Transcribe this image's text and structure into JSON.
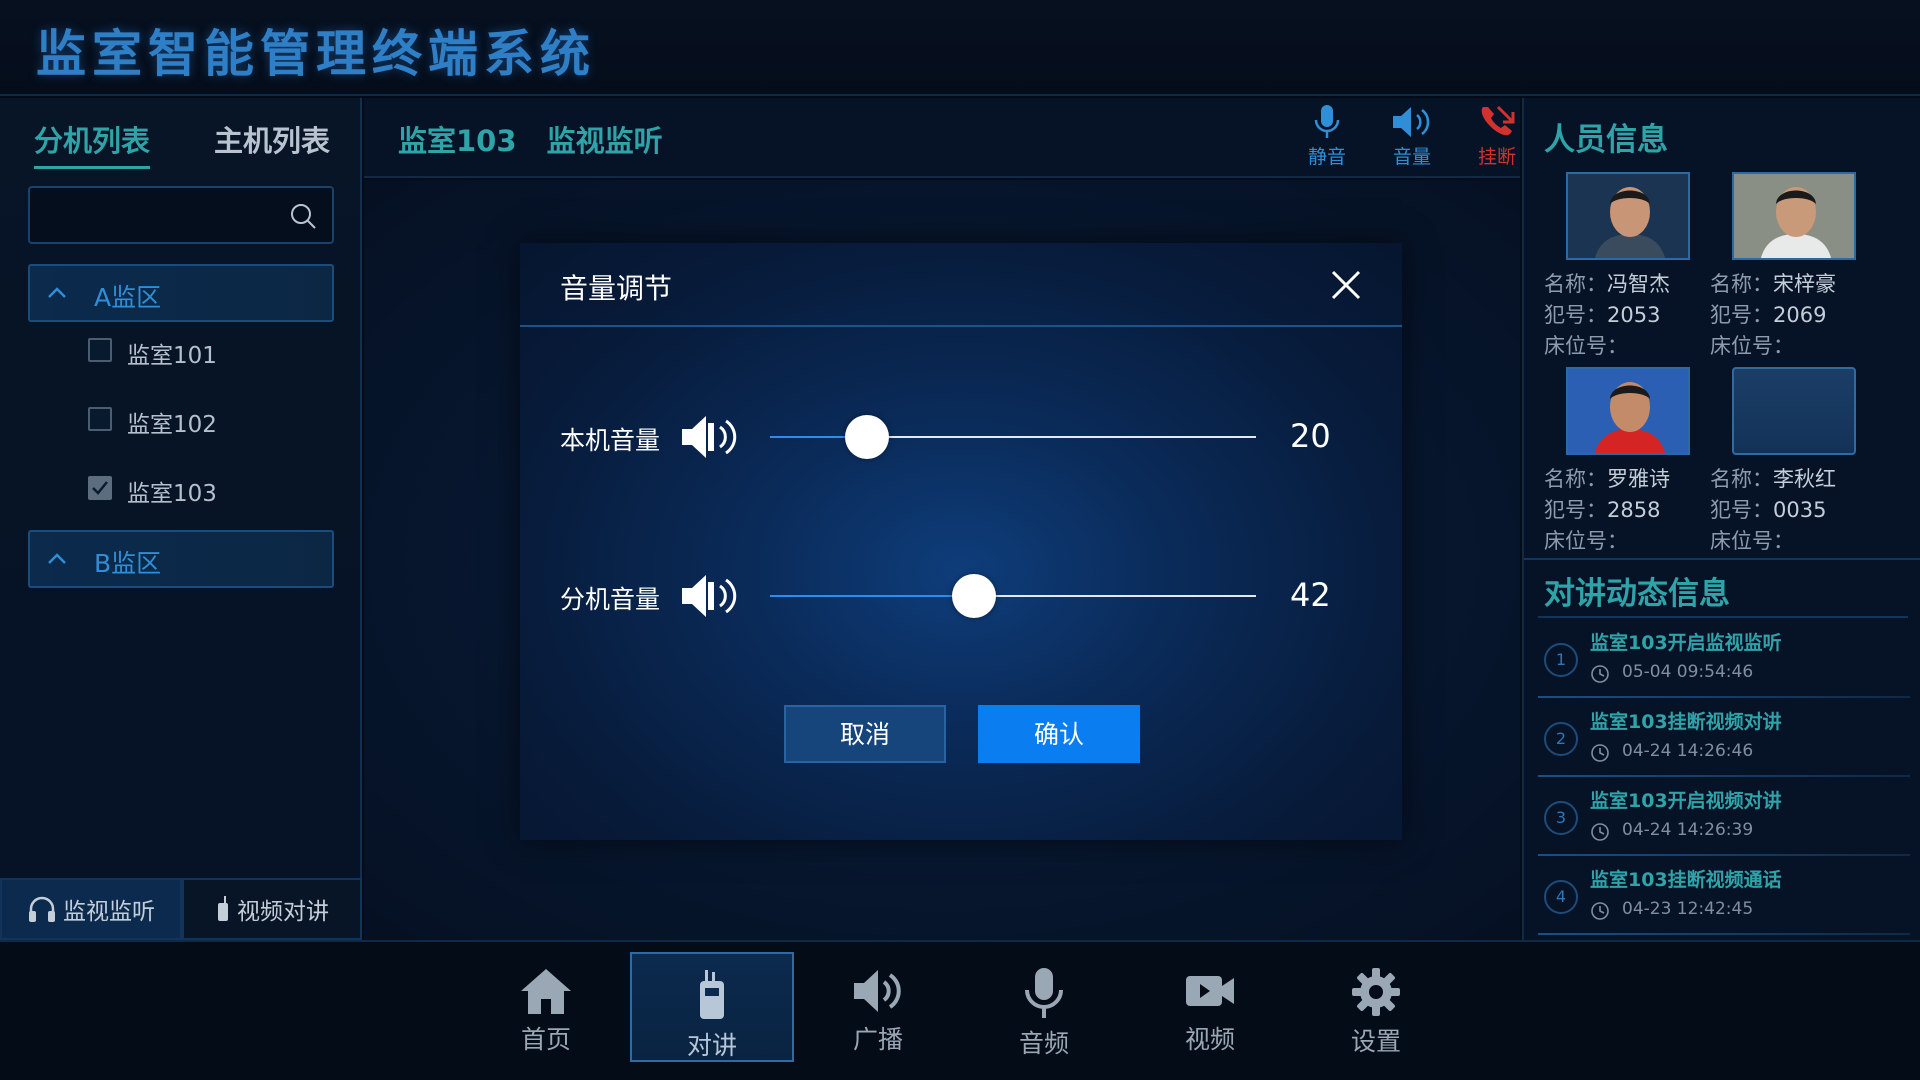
{
  "app": {
    "title": "监室智能管理终端系统"
  },
  "left_panel": {
    "tabs": [
      {
        "label": "分机列表",
        "active": true
      },
      {
        "label": "主机列表",
        "active": false
      }
    ],
    "search": {
      "placeholder": "",
      "value": ""
    },
    "zones": [
      {
        "label": "A监区",
        "expanded": true,
        "rooms": [
          {
            "label": "监室101",
            "checked": false
          },
          {
            "label": "监室102",
            "checked": false
          },
          {
            "label": "监室103",
            "checked": true
          }
        ]
      },
      {
        "label": "B监区",
        "expanded": true,
        "rooms": []
      }
    ],
    "bottom_tabs": [
      {
        "label": "监视监听",
        "icon": "headphones-icon",
        "active": true
      },
      {
        "label": "视频对讲",
        "icon": "walkie-talkie-icon",
        "active": false
      }
    ]
  },
  "center": {
    "breadcrumb": {
      "room": "监室103",
      "mode": "监视监听"
    },
    "controls": [
      {
        "label": "静音",
        "icon": "microphone-icon"
      },
      {
        "label": "音量",
        "icon": "speaker-icon"
      },
      {
        "label": "挂断",
        "icon": "hangup-icon"
      }
    ]
  },
  "volume_dialog": {
    "title": "音量调节",
    "local": {
      "label": "本机音量",
      "value": 20
    },
    "extension": {
      "label": "分机音量",
      "value": 42
    },
    "cancel_label": "取消",
    "confirm_label": "确认"
  },
  "right_panel": {
    "persons_title": "人员信息",
    "name_label": "名称：",
    "number_label": "犯号：",
    "bed_label": "床位号：",
    "persons": [
      {
        "name": "冯智杰",
        "number": "2053",
        "bed": ""
      },
      {
        "name": "宋梓豪",
        "number": "2069",
        "bed": ""
      },
      {
        "name": "罗雅诗",
        "number": "2858",
        "bed": ""
      },
      {
        "name": "李秋红",
        "number": "0035",
        "bed": ""
      }
    ],
    "events_title": "对讲动态信息",
    "events": [
      {
        "num": "1",
        "title": "监室103开启监视监听",
        "time": "05-04 09:54:46"
      },
      {
        "num": "2",
        "title": "监室103挂断视频对讲",
        "time": "04-24 14:26:46"
      },
      {
        "num": "3",
        "title": "监室103开启视频对讲",
        "time": "04-24 14:26:39"
      },
      {
        "num": "4",
        "title": "监室103挂断视频通话",
        "time": "04-23 12:42:45"
      }
    ]
  },
  "bottom_nav": [
    {
      "label": "首页",
      "icon": "home-icon",
      "active": false
    },
    {
      "label": "对讲",
      "icon": "walkie-talkie-icon",
      "active": true
    },
    {
      "label": "广播",
      "icon": "speaker-icon",
      "active": false
    },
    {
      "label": "音频",
      "icon": "microphone-icon",
      "active": false
    },
    {
      "label": "视频",
      "icon": "video-camera-icon",
      "active": false
    },
    {
      "label": "设置",
      "icon": "gear-icon",
      "active": false
    }
  ],
  "colors": {
    "accent_teal": "#2ea3a8",
    "accent_blue": "#2f8ed6",
    "title_blue": "#2f7fc6",
    "hangup_red": "#d2312e",
    "confirm_blue": "#0a7df0"
  }
}
